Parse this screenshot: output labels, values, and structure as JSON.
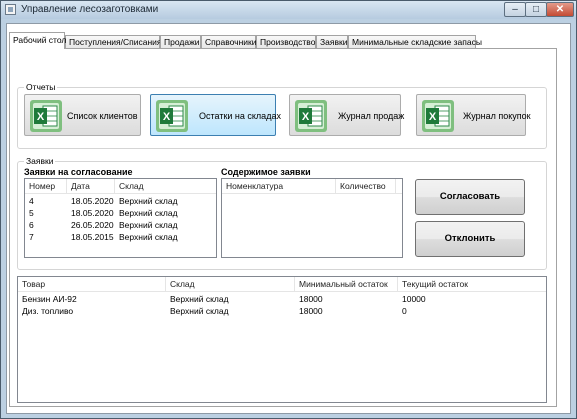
{
  "window": {
    "title": "Управление лесозаготовками"
  },
  "tabs": [
    {
      "label": "Рабочий стол"
    },
    {
      "label": "Поступления/Списания"
    },
    {
      "label": "Продажи"
    },
    {
      "label": "Справочники"
    },
    {
      "label": "Производство"
    },
    {
      "label": "Заявки"
    },
    {
      "label": "Минимальные складские запасы"
    }
  ],
  "reports": {
    "group_label": "Отчеты",
    "buttons": [
      {
        "label": "Список клиентов",
        "icon": "excel-icon"
      },
      {
        "label": "Остатки на складах",
        "icon": "excel-icon"
      },
      {
        "label": "Журнал продаж",
        "icon": "excel-icon"
      },
      {
        "label": "Журнал покупок",
        "icon": "excel-icon"
      }
    ]
  },
  "requests": {
    "group_label": "Заявки",
    "pending_title": "Заявки на согласование",
    "pending_columns": [
      "Номер",
      "Дата",
      "Склад"
    ],
    "pending_rows": [
      {
        "num": "4",
        "date": "18.05.2020",
        "store": "Верхний склад"
      },
      {
        "num": "5",
        "date": "18.05.2020",
        "store": "Верхний склад"
      },
      {
        "num": "6",
        "date": "26.05.2020",
        "store": "Верхний склад"
      },
      {
        "num": "7",
        "date": "18.05.2015",
        "store": "Верхний склад"
      }
    ],
    "content_title": "Содержимое заявки",
    "content_columns": [
      "Номенклатура",
      "Количество"
    ],
    "approve_label": "Согласовать",
    "reject_label": "Отклонить"
  },
  "stock": {
    "columns": [
      "Товар",
      "Склад",
      "Минимальный остаток",
      "Текущий остаток"
    ],
    "rows": [
      {
        "product": "Бензин АИ-92",
        "store": "Верхний склад",
        "min": "18000",
        "current": "10000"
      },
      {
        "product": "Диз. топливо",
        "store": "Верхний склад",
        "min": "18000",
        "current": "0"
      }
    ]
  },
  "colors": {
    "selected_button": "#bee6fd",
    "excel_green": "#1f7a3a"
  }
}
